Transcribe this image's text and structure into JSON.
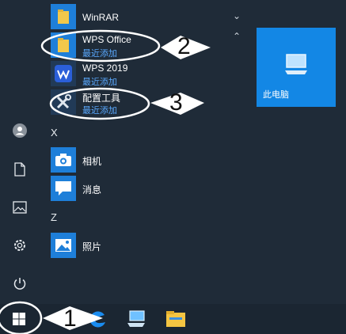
{
  "start_menu": {
    "apps": {
      "winrar": "WinRAR",
      "wps_office": {
        "name": "WPS Office",
        "sub": "最近添加"
      },
      "wps_2019": {
        "name": "WPS 2019",
        "sub": "最近添加"
      },
      "config_tool": {
        "name": "配置工具",
        "sub": "最近添加"
      },
      "camera": "相机",
      "messages": "消息",
      "photos": "照片"
    },
    "section_letters": [
      "X",
      "Z"
    ],
    "tile": {
      "label": "此电脑"
    }
  },
  "annotations": [
    "1",
    "2",
    "3"
  ],
  "colors": {
    "accent": "#1387e5",
    "recent_text": "#5aa9ff",
    "menu_bg": "#1f2b38",
    "taskbar_bg": "#1b2632"
  },
  "icons": {
    "rail": [
      "user-icon",
      "document-icon",
      "pictures-icon",
      "settings-icon",
      "power-icon"
    ],
    "taskbar": [
      "windows-start-icon",
      "edge-icon",
      "computer-icon",
      "file-explorer-icon"
    ]
  }
}
